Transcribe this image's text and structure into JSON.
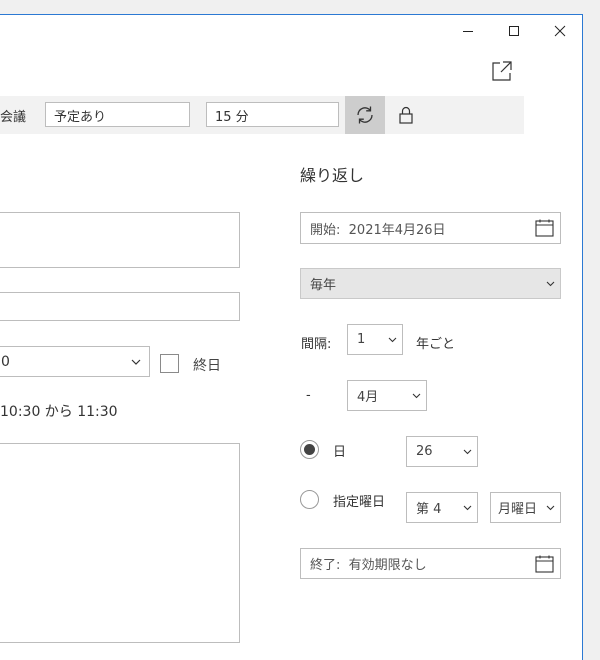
{
  "toolbar": {
    "meeting_label": "会議",
    "busy_status": "予定あり",
    "reminder": "15 分"
  },
  "left": {
    "start_time_partial": "0",
    "all_day_label": "終日",
    "time_range": "10:30 から 11:30"
  },
  "recurrence": {
    "title": "繰り返し",
    "start_label": "開始:",
    "start_date": "2021年4月26日",
    "frequency": "毎年",
    "interval_label": "間隔:",
    "interval_value": "1",
    "interval_unit": "年ごと",
    "dash": "-",
    "month": "4月",
    "day_label": "日",
    "day_value": "26",
    "weekday_label": "指定曜日",
    "week_ordinal": "第 4",
    "weekday": "月曜日",
    "end_label": "終了:",
    "end_value": "有効期限なし"
  }
}
